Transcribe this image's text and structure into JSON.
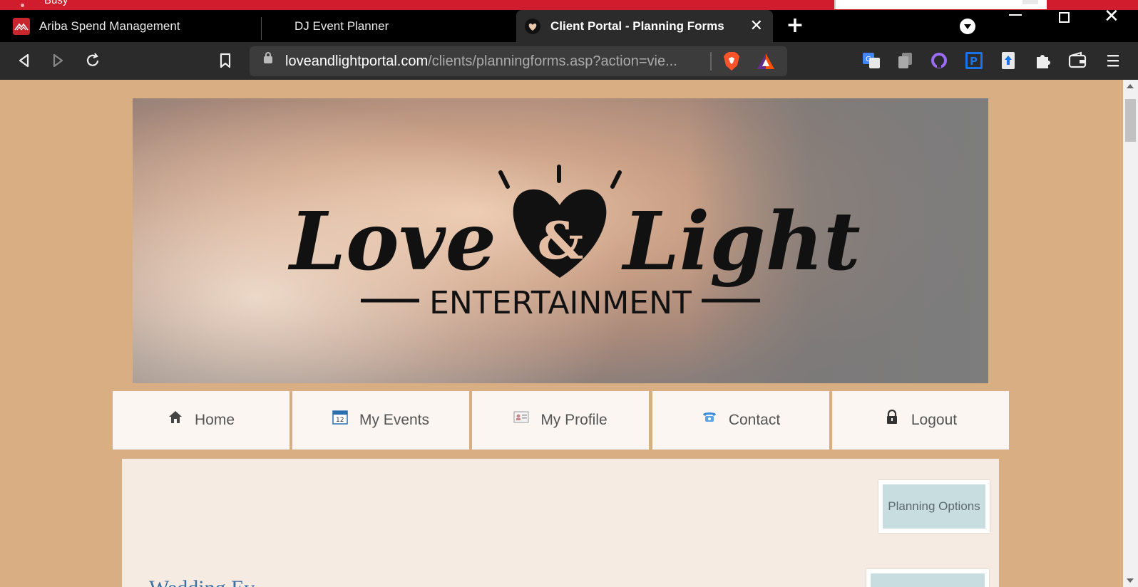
{
  "os": {
    "status_text": "Busy"
  },
  "tabs": [
    {
      "title": "Ariba Spend Management",
      "favicon": "ariba-icon"
    },
    {
      "title": "DJ Event Planner",
      "favicon": "none"
    },
    {
      "title": "Client Portal - Planning Forms",
      "favicon": "love-light-icon",
      "active": true
    }
  ],
  "toolbar": {
    "url_domain": "loveandlightportal.com",
    "url_path": "/clients/planningforms.asp?action=vie..."
  },
  "banner": {
    "logo_word_left": "Love",
    "logo_ampersand": "&",
    "logo_word_right": "Light",
    "logo_subtitle": "ENTERTAINMENT"
  },
  "nav": {
    "items": [
      {
        "label": "Home",
        "icon": "home-icon"
      },
      {
        "label": "My Events",
        "icon": "calendar-icon"
      },
      {
        "label": "My Profile",
        "icon": "id-card-icon"
      },
      {
        "label": "Contact",
        "icon": "telephone-icon"
      },
      {
        "label": "Logout",
        "icon": "lock-icon"
      }
    ]
  },
  "content": {
    "planning_options_label": "Planning Options",
    "partial_heading": "Wedding Ev"
  },
  "colors": {
    "page_bg": "#d9ae82",
    "nav_bg": "#fbf6f1",
    "content_bg": "#f6ebe3",
    "button_bg": "#c8dde0",
    "os_strip": "#d01c2c"
  }
}
